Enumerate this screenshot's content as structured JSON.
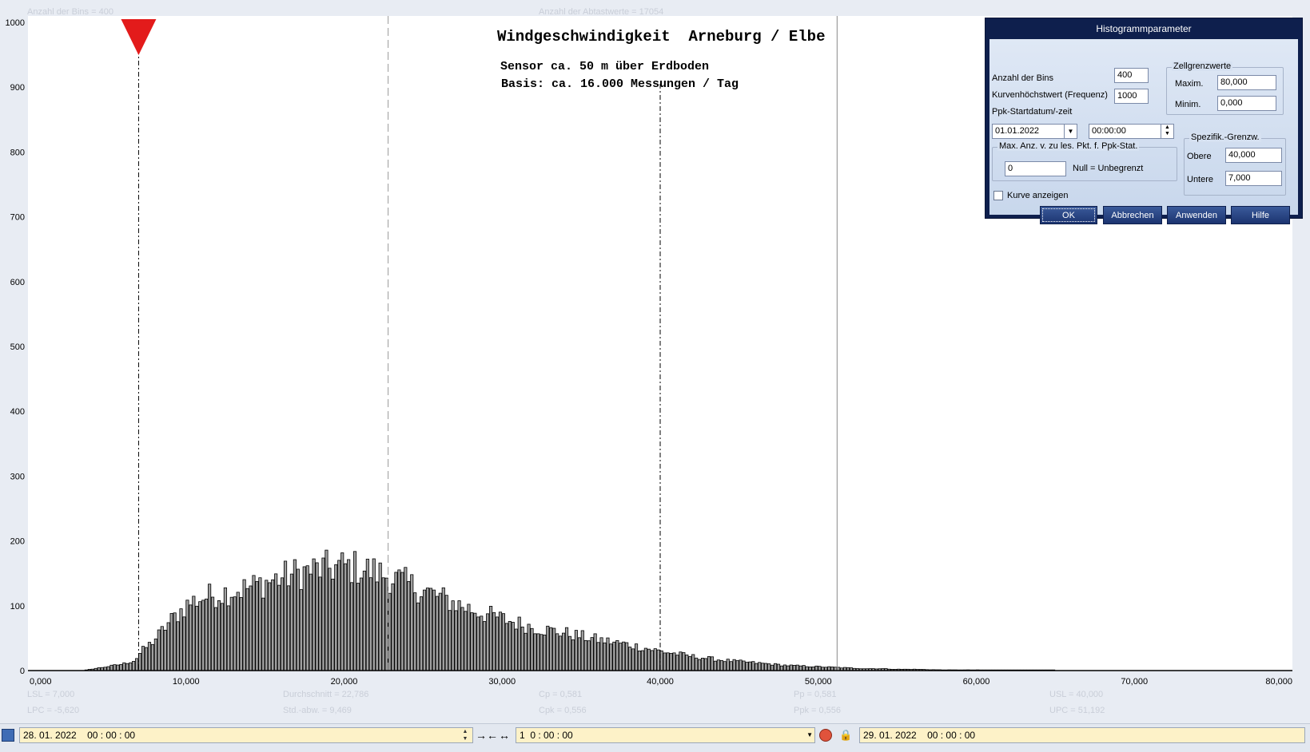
{
  "top_info": {
    "bins_text": "Anzahl der Bins =   400",
    "samples_text": "Anzahl der Abtastwerte = 17054"
  },
  "chart_data": {
    "type": "bar",
    "title": "Windgeschwindigkeit  Arneburg / Elbe",
    "subtitle1": "Sensor ca. 50 m über Erdboden",
    "subtitle2": "Basis: ca. 16.000 Messungen / Tag",
    "xlim": [
      0,
      80
    ],
    "ylim": [
      0,
      1000
    ],
    "bin_width": 0.2,
    "x_tick_values": [
      0,
      10,
      20,
      30,
      40,
      50,
      60,
      70,
      80
    ],
    "x_tick_labels": [
      "0,000",
      "10,000",
      "20,000",
      "30,000",
      "40,000",
      "50,000",
      "60,000",
      "70,000",
      "80,000"
    ],
    "y_ticks": [
      0,
      100,
      200,
      300,
      400,
      500,
      600,
      700,
      800,
      900,
      1000
    ],
    "lines": {
      "lsl": 7.0,
      "mean": 22.786,
      "usl": 40.0,
      "upc": 51.192
    },
    "marker_at": 7.0,
    "control_points": [
      [
        3.5,
        0
      ],
      [
        4.2,
        3
      ],
      [
        5.0,
        6
      ],
      [
        6.0,
        10
      ],
      [
        6.8,
        16
      ],
      [
        7.2,
        30
      ],
      [
        7.8,
        42
      ],
      [
        8.4,
        58
      ],
      [
        9.0,
        76
      ],
      [
        9.6,
        90
      ],
      [
        10.2,
        104
      ],
      [
        11.0,
        112
      ],
      [
        12.0,
        118
      ],
      [
        13.0,
        123
      ],
      [
        14.0,
        128
      ],
      [
        15.0,
        136
      ],
      [
        16.0,
        143
      ],
      [
        17.0,
        150
      ],
      [
        18.0,
        155
      ],
      [
        19.0,
        158
      ],
      [
        20.0,
        161
      ],
      [
        21.0,
        158
      ],
      [
        22.0,
        152
      ],
      [
        23.0,
        144
      ],
      [
        24.0,
        134
      ],
      [
        25.0,
        124
      ],
      [
        26.0,
        114
      ],
      [
        27.0,
        104
      ],
      [
        28.0,
        95
      ],
      [
        29.0,
        87
      ],
      [
        30.0,
        80
      ],
      [
        31.0,
        73
      ],
      [
        32.0,
        67
      ],
      [
        33.0,
        62
      ],
      [
        34.0,
        58
      ],
      [
        35.0,
        53
      ],
      [
        36.0,
        48
      ],
      [
        37.0,
        44
      ],
      [
        38.0,
        40
      ],
      [
        39.0,
        35
      ],
      [
        40.0,
        30
      ],
      [
        41.0,
        26
      ],
      [
        42.0,
        22
      ],
      [
        43.0,
        19
      ],
      [
        44.0,
        16
      ],
      [
        45.0,
        14
      ],
      [
        46.0,
        12
      ],
      [
        47.0,
        10
      ],
      [
        48.0,
        8
      ],
      [
        49.0,
        7
      ],
      [
        50.0,
        6
      ],
      [
        51.0,
        5
      ],
      [
        52.0,
        4
      ],
      [
        53.0,
        3
      ],
      [
        54.0,
        3
      ],
      [
        55.0,
        2
      ],
      [
        56.0,
        2
      ],
      [
        58.0,
        1
      ],
      [
        60.0,
        1
      ],
      [
        62.0,
        0.5
      ],
      [
        77.0,
        0
      ]
    ]
  },
  "stats": {
    "lsl": "LSL = 7,000",
    "lpc": "LPC = -5,620",
    "mean": "Durchschnitt  = 22,786",
    "std": "Std.-abw. = 9,469",
    "cp": "Cp  = 0,581",
    "cpk": "Cpk = 0,556",
    "pp": "Pp  = 0,581",
    "ppk": "Ppk = 0,556",
    "usl": "USL = 40,000",
    "upc": "UPC = 51,192"
  },
  "dialog": {
    "title": "Histogrammparameter",
    "bins_label": "Anzahl der Bins",
    "bins_value": "400",
    "max_freq_label": "Kurvenhöchstwert (Frequenz)",
    "max_freq_value": "1000",
    "ppk_start_label": "Ppk-Startdatum/-zeit",
    "date_value": "01.01.2022",
    "time_value": "00:00:00",
    "cell_group": "Zellgrenzwerte",
    "maxim_label": "Maxim.",
    "maxim_value": "80,000",
    "minim_label": "Minim.",
    "minim_value": "0,000",
    "spec_group": "Spezifik.-Grenzw.",
    "upper_label": "Obere",
    "upper_value": "40,000",
    "lower_label": "Untere",
    "lower_value": "7,000",
    "maxpts_group": "Max. Anz. v. zu les. Pkt. f. Ppk-Stat.",
    "maxpts_value": "0",
    "null_note": "Null = Unbegrenzt",
    "curve_label": "Kurve anzeigen",
    "ok": "OK",
    "cancel": "Abbrechen",
    "apply": "Anwenden",
    "help": "Hilfe"
  },
  "bottom": {
    "start": "28. 01. 2022    00 : 00 : 00",
    "duration": "1  0 : 00 : 00",
    "end": "29. 01. 2022    00 : 00 : 00"
  },
  "colors": {
    "bar_fill": "#a0a0a0",
    "marker": "#e31b1b",
    "dialog_bg": "#0e1f4d"
  }
}
